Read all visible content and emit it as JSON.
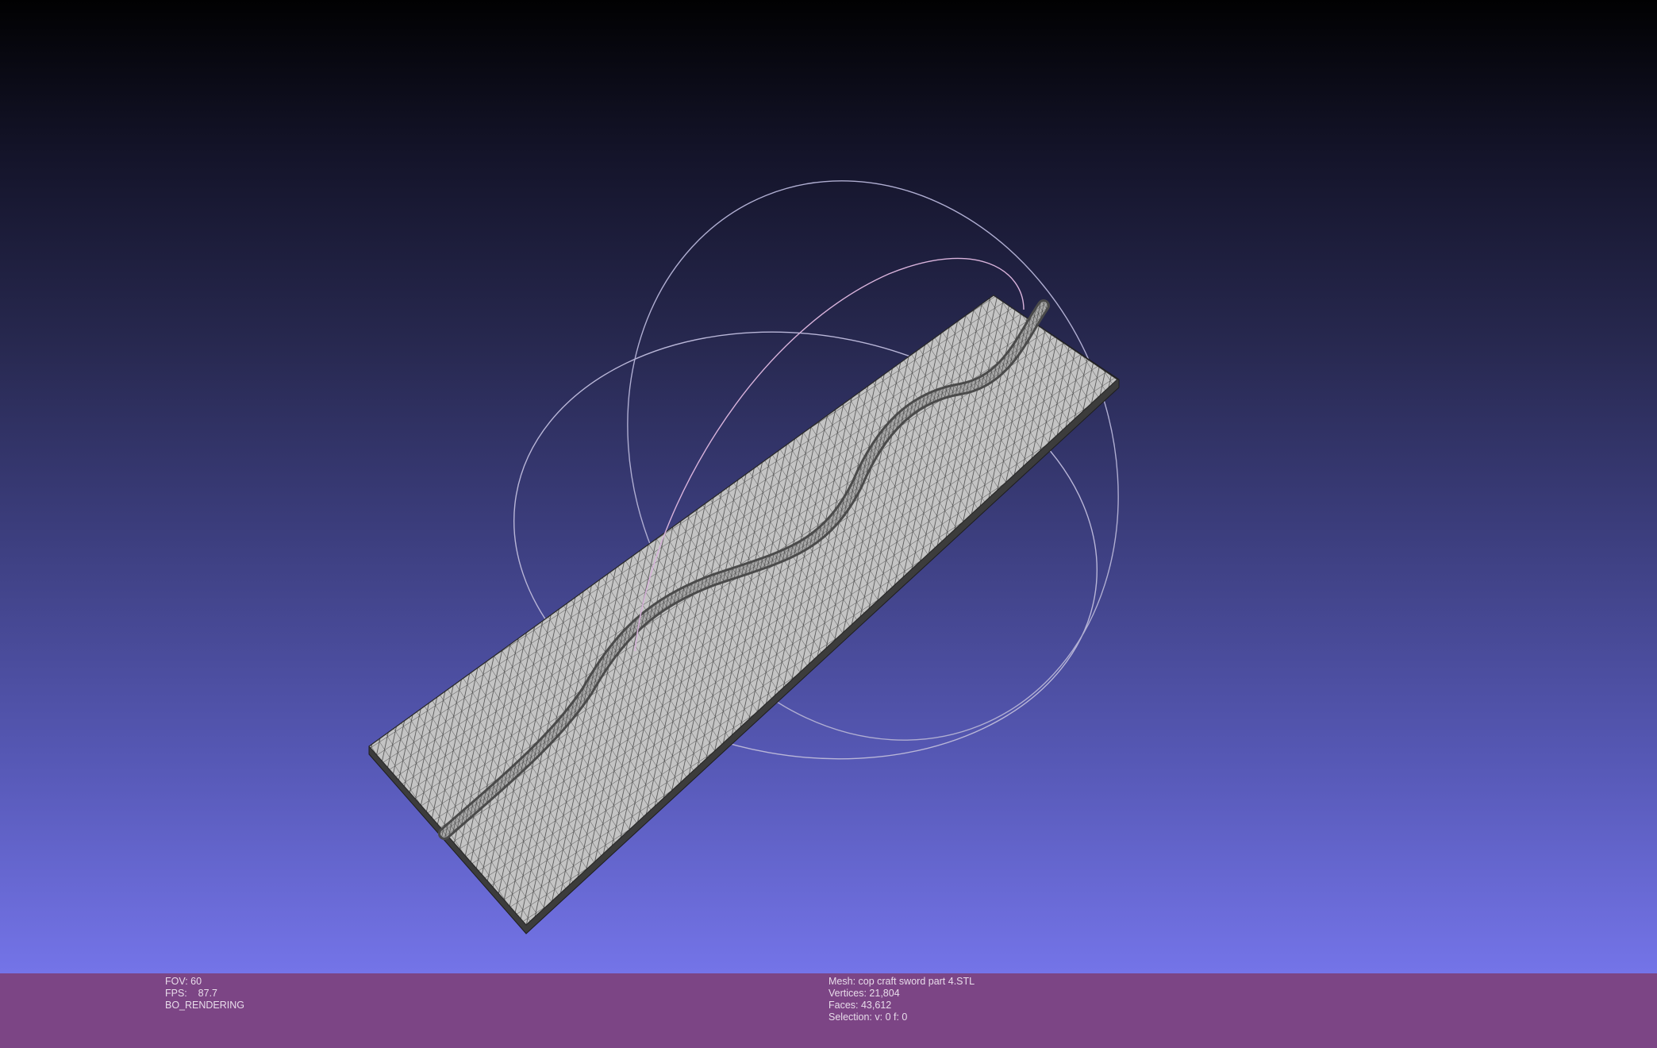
{
  "viewer": {
    "background_top": "#010102",
    "background_bottom": "#7474e8",
    "statusbar_color": "#7c4585",
    "mesh_fill": "#bdbdbd",
    "wire_color": "#2a2a2a",
    "trackball_colors": [
      "#a8a8c8",
      "#d8b4d8",
      "#c8c8e0"
    ]
  },
  "render_info": {
    "fov": "FOV: 60",
    "fps": "FPS:    87.7",
    "mode": "BO_RENDERING"
  },
  "mesh_info": {
    "mesh": "Mesh: cop craft sword part 4.STL",
    "vertices": "Vertices: 21,804",
    "faces": "Faces: 43,612",
    "selection": "Selection: v: 0 f: 0"
  }
}
